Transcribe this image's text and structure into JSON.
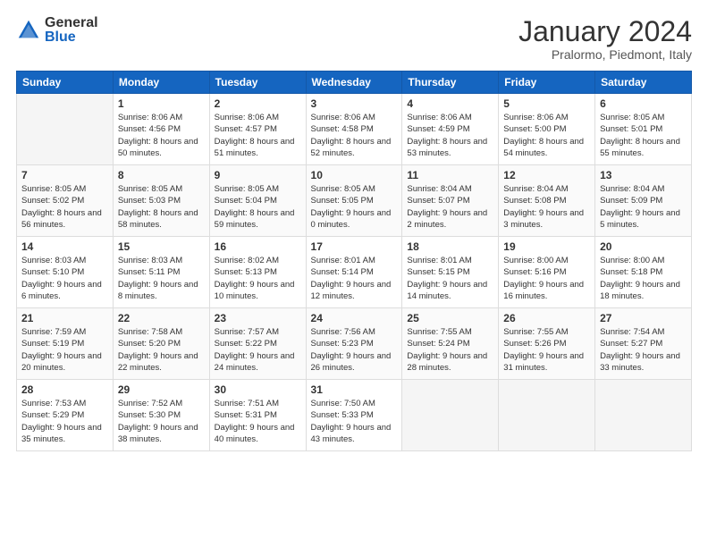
{
  "logo": {
    "general": "General",
    "blue": "Blue"
  },
  "header": {
    "month": "January 2024",
    "location": "Pralormo, Piedmont, Italy"
  },
  "weekdays": [
    "Sunday",
    "Monday",
    "Tuesday",
    "Wednesday",
    "Thursday",
    "Friday",
    "Saturday"
  ],
  "weeks": [
    [
      {
        "day": "",
        "sunrise": "",
        "sunset": "",
        "daylight": "",
        "empty": true
      },
      {
        "day": "1",
        "sunrise": "Sunrise: 8:06 AM",
        "sunset": "Sunset: 4:56 PM",
        "daylight": "Daylight: 8 hours and 50 minutes.",
        "empty": false
      },
      {
        "day": "2",
        "sunrise": "Sunrise: 8:06 AM",
        "sunset": "Sunset: 4:57 PM",
        "daylight": "Daylight: 8 hours and 51 minutes.",
        "empty": false
      },
      {
        "day": "3",
        "sunrise": "Sunrise: 8:06 AM",
        "sunset": "Sunset: 4:58 PM",
        "daylight": "Daylight: 8 hours and 52 minutes.",
        "empty": false
      },
      {
        "day": "4",
        "sunrise": "Sunrise: 8:06 AM",
        "sunset": "Sunset: 4:59 PM",
        "daylight": "Daylight: 8 hours and 53 minutes.",
        "empty": false
      },
      {
        "day": "5",
        "sunrise": "Sunrise: 8:06 AM",
        "sunset": "Sunset: 5:00 PM",
        "daylight": "Daylight: 8 hours and 54 minutes.",
        "empty": false
      },
      {
        "day": "6",
        "sunrise": "Sunrise: 8:05 AM",
        "sunset": "Sunset: 5:01 PM",
        "daylight": "Daylight: 8 hours and 55 minutes.",
        "empty": false
      }
    ],
    [
      {
        "day": "7",
        "sunrise": "Sunrise: 8:05 AM",
        "sunset": "Sunset: 5:02 PM",
        "daylight": "Daylight: 8 hours and 56 minutes.",
        "empty": false
      },
      {
        "day": "8",
        "sunrise": "Sunrise: 8:05 AM",
        "sunset": "Sunset: 5:03 PM",
        "daylight": "Daylight: 8 hours and 58 minutes.",
        "empty": false
      },
      {
        "day": "9",
        "sunrise": "Sunrise: 8:05 AM",
        "sunset": "Sunset: 5:04 PM",
        "daylight": "Daylight: 8 hours and 59 minutes.",
        "empty": false
      },
      {
        "day": "10",
        "sunrise": "Sunrise: 8:05 AM",
        "sunset": "Sunset: 5:05 PM",
        "daylight": "Daylight: 9 hours and 0 minutes.",
        "empty": false
      },
      {
        "day": "11",
        "sunrise": "Sunrise: 8:04 AM",
        "sunset": "Sunset: 5:07 PM",
        "daylight": "Daylight: 9 hours and 2 minutes.",
        "empty": false
      },
      {
        "day": "12",
        "sunrise": "Sunrise: 8:04 AM",
        "sunset": "Sunset: 5:08 PM",
        "daylight": "Daylight: 9 hours and 3 minutes.",
        "empty": false
      },
      {
        "day": "13",
        "sunrise": "Sunrise: 8:04 AM",
        "sunset": "Sunset: 5:09 PM",
        "daylight": "Daylight: 9 hours and 5 minutes.",
        "empty": false
      }
    ],
    [
      {
        "day": "14",
        "sunrise": "Sunrise: 8:03 AM",
        "sunset": "Sunset: 5:10 PM",
        "daylight": "Daylight: 9 hours and 6 minutes.",
        "empty": false
      },
      {
        "day": "15",
        "sunrise": "Sunrise: 8:03 AM",
        "sunset": "Sunset: 5:11 PM",
        "daylight": "Daylight: 9 hours and 8 minutes.",
        "empty": false
      },
      {
        "day": "16",
        "sunrise": "Sunrise: 8:02 AM",
        "sunset": "Sunset: 5:13 PM",
        "daylight": "Daylight: 9 hours and 10 minutes.",
        "empty": false
      },
      {
        "day": "17",
        "sunrise": "Sunrise: 8:01 AM",
        "sunset": "Sunset: 5:14 PM",
        "daylight": "Daylight: 9 hours and 12 minutes.",
        "empty": false
      },
      {
        "day": "18",
        "sunrise": "Sunrise: 8:01 AM",
        "sunset": "Sunset: 5:15 PM",
        "daylight": "Daylight: 9 hours and 14 minutes.",
        "empty": false
      },
      {
        "day": "19",
        "sunrise": "Sunrise: 8:00 AM",
        "sunset": "Sunset: 5:16 PM",
        "daylight": "Daylight: 9 hours and 16 minutes.",
        "empty": false
      },
      {
        "day": "20",
        "sunrise": "Sunrise: 8:00 AM",
        "sunset": "Sunset: 5:18 PM",
        "daylight": "Daylight: 9 hours and 18 minutes.",
        "empty": false
      }
    ],
    [
      {
        "day": "21",
        "sunrise": "Sunrise: 7:59 AM",
        "sunset": "Sunset: 5:19 PM",
        "daylight": "Daylight: 9 hours and 20 minutes.",
        "empty": false
      },
      {
        "day": "22",
        "sunrise": "Sunrise: 7:58 AM",
        "sunset": "Sunset: 5:20 PM",
        "daylight": "Daylight: 9 hours and 22 minutes.",
        "empty": false
      },
      {
        "day": "23",
        "sunrise": "Sunrise: 7:57 AM",
        "sunset": "Sunset: 5:22 PM",
        "daylight": "Daylight: 9 hours and 24 minutes.",
        "empty": false
      },
      {
        "day": "24",
        "sunrise": "Sunrise: 7:56 AM",
        "sunset": "Sunset: 5:23 PM",
        "daylight": "Daylight: 9 hours and 26 minutes.",
        "empty": false
      },
      {
        "day": "25",
        "sunrise": "Sunrise: 7:55 AM",
        "sunset": "Sunset: 5:24 PM",
        "daylight": "Daylight: 9 hours and 28 minutes.",
        "empty": false
      },
      {
        "day": "26",
        "sunrise": "Sunrise: 7:55 AM",
        "sunset": "Sunset: 5:26 PM",
        "daylight": "Daylight: 9 hours and 31 minutes.",
        "empty": false
      },
      {
        "day": "27",
        "sunrise": "Sunrise: 7:54 AM",
        "sunset": "Sunset: 5:27 PM",
        "daylight": "Daylight: 9 hours and 33 minutes.",
        "empty": false
      }
    ],
    [
      {
        "day": "28",
        "sunrise": "Sunrise: 7:53 AM",
        "sunset": "Sunset: 5:29 PM",
        "daylight": "Daylight: 9 hours and 35 minutes.",
        "empty": false
      },
      {
        "day": "29",
        "sunrise": "Sunrise: 7:52 AM",
        "sunset": "Sunset: 5:30 PM",
        "daylight": "Daylight: 9 hours and 38 minutes.",
        "empty": false
      },
      {
        "day": "30",
        "sunrise": "Sunrise: 7:51 AM",
        "sunset": "Sunset: 5:31 PM",
        "daylight": "Daylight: 9 hours and 40 minutes.",
        "empty": false
      },
      {
        "day": "31",
        "sunrise": "Sunrise: 7:50 AM",
        "sunset": "Sunset: 5:33 PM",
        "daylight": "Daylight: 9 hours and 43 minutes.",
        "empty": false
      },
      {
        "day": "",
        "sunrise": "",
        "sunset": "",
        "daylight": "",
        "empty": true
      },
      {
        "day": "",
        "sunrise": "",
        "sunset": "",
        "daylight": "",
        "empty": true
      },
      {
        "day": "",
        "sunrise": "",
        "sunset": "",
        "daylight": "",
        "empty": true
      }
    ]
  ]
}
